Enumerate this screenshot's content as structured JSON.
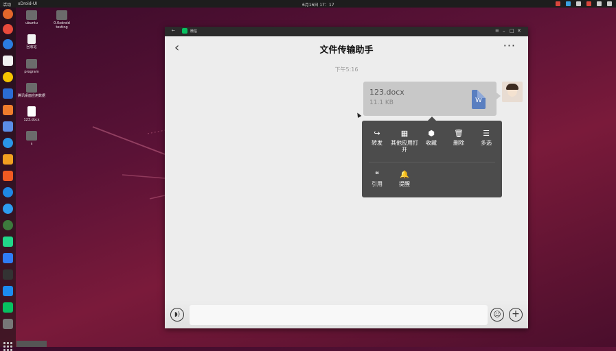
{
  "topbar": {
    "activities": "活动",
    "app_menu": "xDroid-UI",
    "clock": "6月16日 17：17"
  },
  "desktop": {
    "icons": [
      {
        "label": "ubuntu"
      },
      {
        "label": "回收站"
      },
      {
        "label": "program"
      },
      {
        "label": "腾讯桌面应用数据"
      },
      {
        "label": "123.docx"
      },
      {
        "label": "s"
      },
      {
        "label": "0.0xdroid testing"
      }
    ]
  },
  "window": {
    "app_name": "微信",
    "chat_title": "文件传输助手",
    "more_label": "···",
    "timestamp": "下午5:16",
    "file": {
      "name": "123.docx",
      "size": "11.1 KB",
      "type_letter": "W"
    },
    "context_menu": {
      "row1": [
        {
          "label": "转发",
          "icon": "forward-icon"
        },
        {
          "label": "其他应用打开",
          "icon": "apps-icon"
        },
        {
          "label": "收藏",
          "icon": "favorite-icon"
        },
        {
          "label": "删除",
          "icon": "trash-icon"
        },
        {
          "label": "多选",
          "icon": "multiselect-icon"
        }
      ],
      "row2": [
        {
          "label": "引用",
          "icon": "quote-icon"
        },
        {
          "label": "提醒",
          "icon": "bell-icon"
        }
      ]
    },
    "input": {
      "placeholder": ""
    }
  },
  "colors": {
    "menu_bg": "#4c4c4c",
    "bubble_bg": "#c8c8c8",
    "wechat_green": "#07c160",
    "word_blue": "#5a7fc0"
  }
}
